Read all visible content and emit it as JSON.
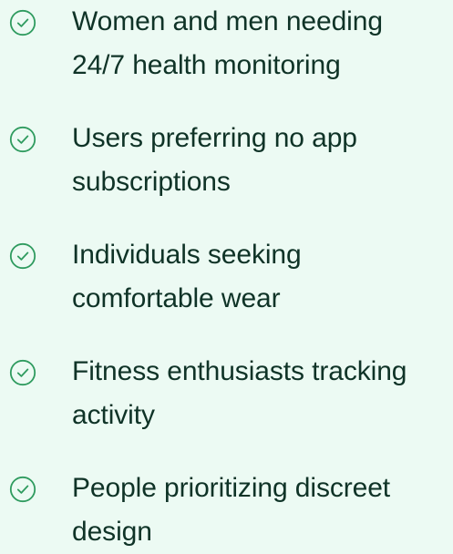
{
  "colors": {
    "background": "#ecfaf3",
    "text": "#0f3327",
    "check": "#2f9b5f"
  },
  "icon": "check-circle-icon",
  "items": [
    {
      "label": "Women and men needing\n24/7 health monitoring"
    },
    {
      "label": "Users preferring no app\nsubscriptions"
    },
    {
      "label": "Individuals seeking\ncomfortable wear"
    },
    {
      "label": "Fitness enthusiasts tracking\nactivity"
    },
    {
      "label": "People prioritizing discreet\ndesign"
    }
  ]
}
